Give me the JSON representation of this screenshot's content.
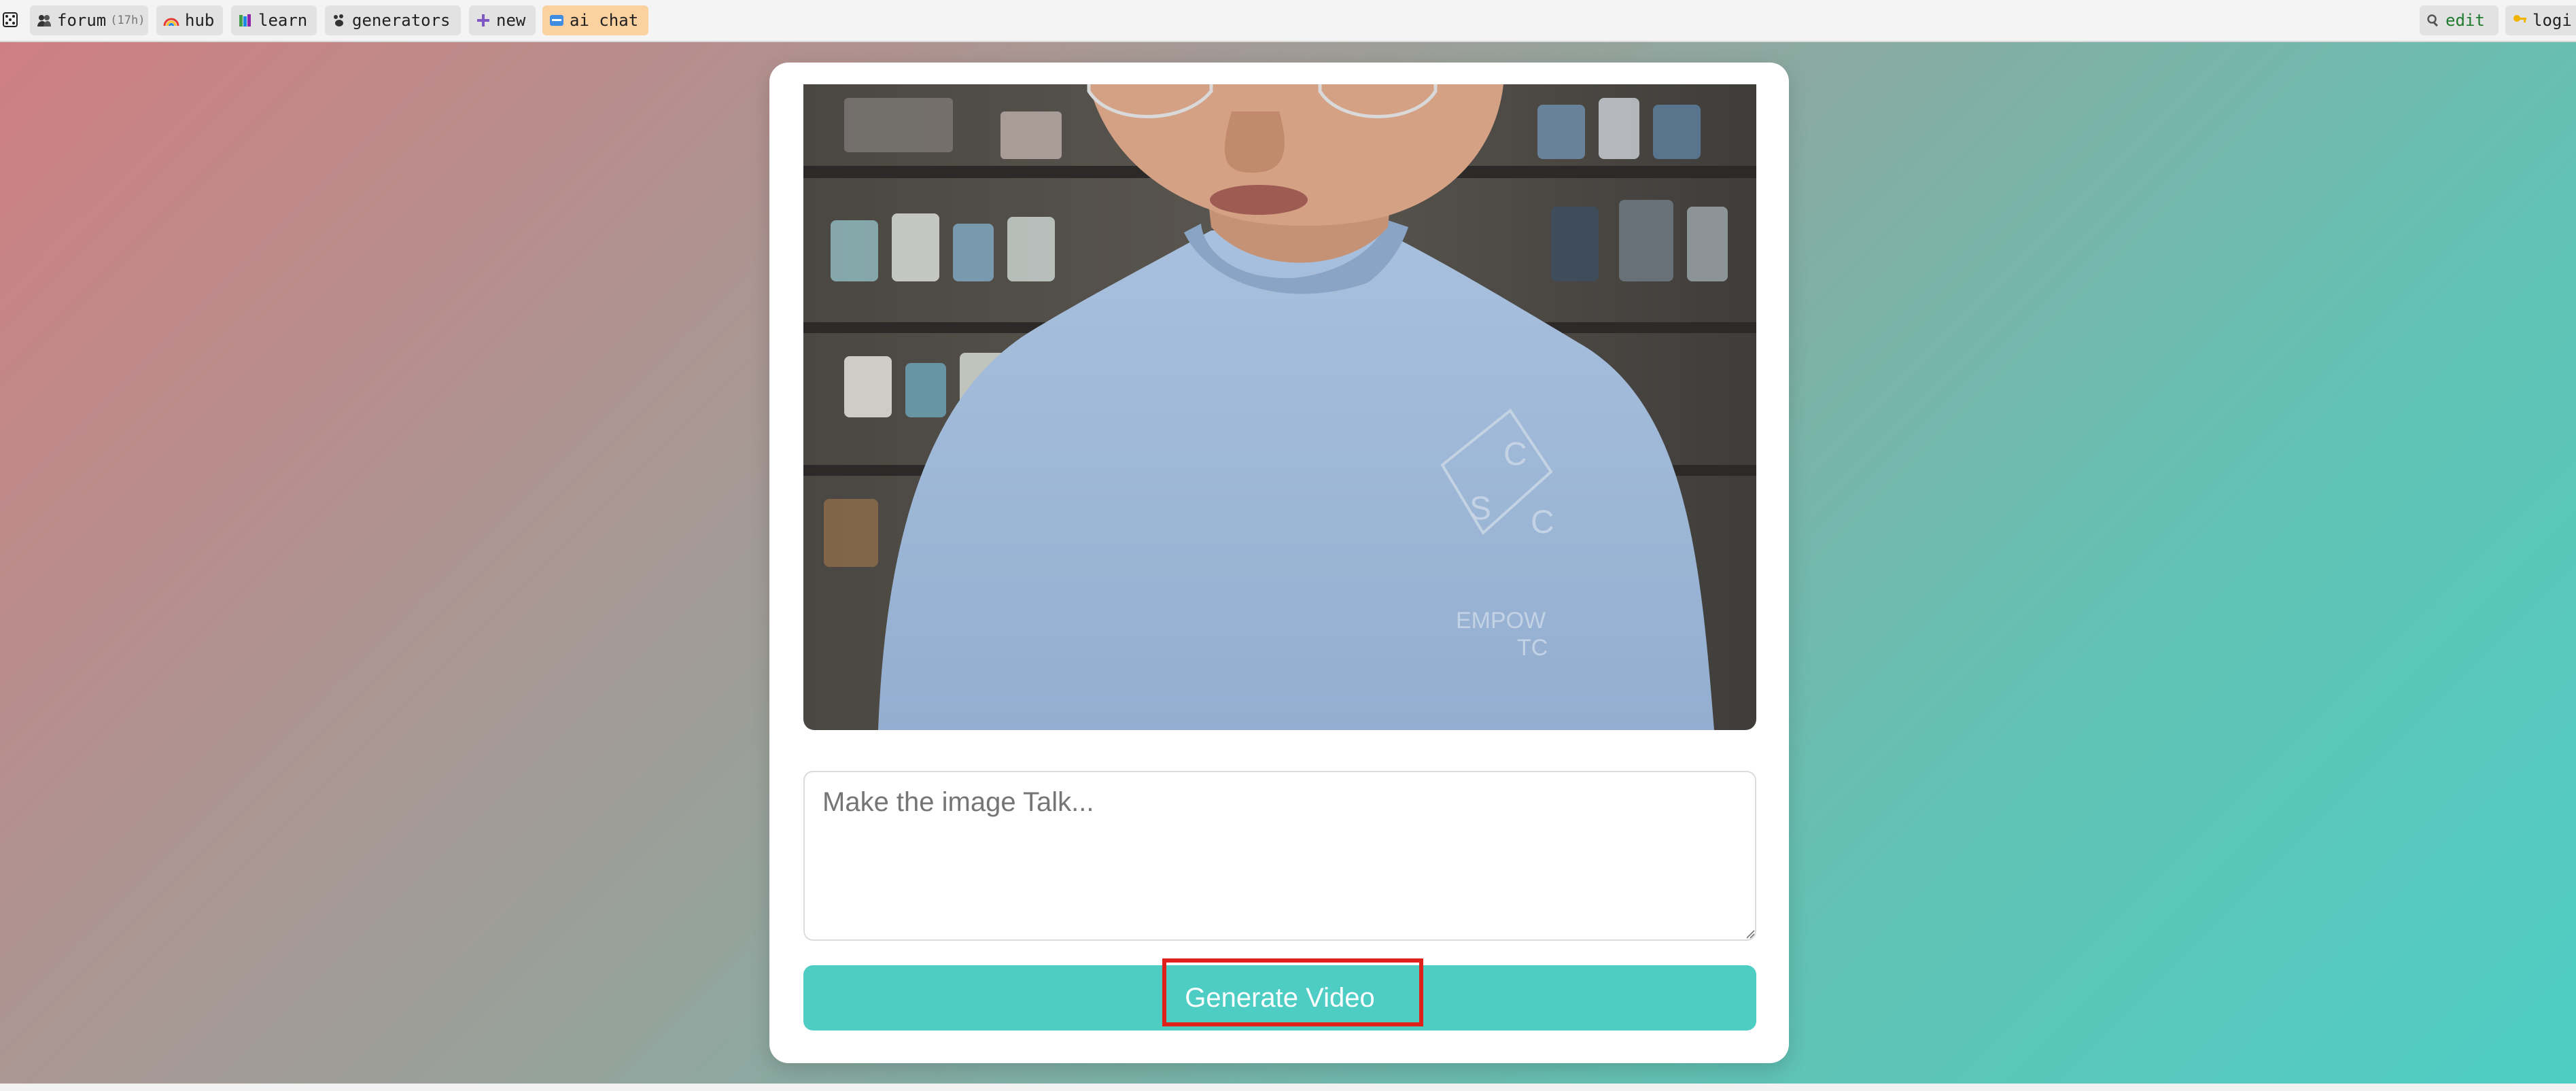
{
  "topbar": {
    "close_icon": "dice-icon",
    "items": [
      {
        "label": "forum",
        "badge": "(17h)",
        "icon": "people-icon"
      },
      {
        "label": "hub",
        "icon": "rainbow-icon"
      },
      {
        "label": "learn",
        "icon": "books-icon"
      },
      {
        "label": "generators",
        "icon": "paw-icon"
      },
      {
        "label": "new",
        "icon": "plus-icon"
      },
      {
        "label": "ai chat",
        "icon": "new-badge-icon"
      }
    ],
    "right": [
      {
        "label": "edit",
        "icon": "magnifier-icon"
      },
      {
        "label": "logi",
        "icon": "key-icon"
      }
    ]
  },
  "colors": {
    "accent": "#4ecdc4",
    "gradient_start": "#cf7f82",
    "gradient_end": "#4ecdc4",
    "highlight": "#e0201b",
    "ai_chat_bg": "#fcd1a0"
  },
  "main": {
    "image_alt": "person in light blue sweatshirt",
    "prompt_placeholder": "Make the image Talk...",
    "prompt_value": "",
    "generate_label": "Generate Video"
  }
}
